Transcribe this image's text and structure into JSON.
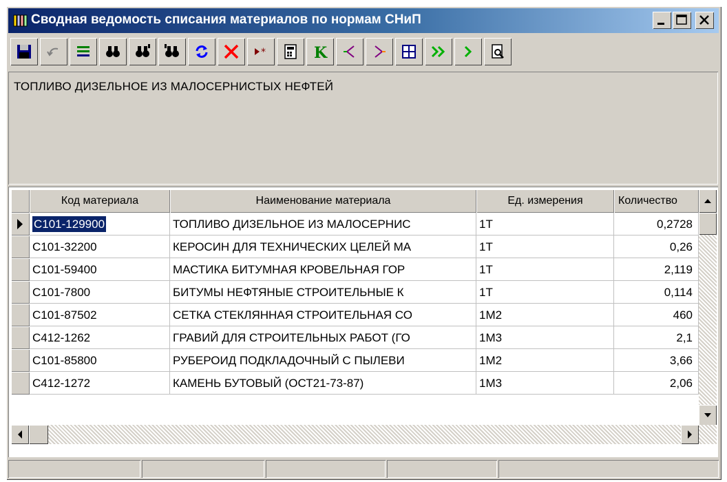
{
  "window": {
    "title": "Сводная ведомость списания материалов по нормам СНиП",
    "controls": [
      "minimize",
      "maximize",
      "close"
    ]
  },
  "toolbar": {
    "buttons": [
      {
        "name": "save",
        "icon": "floppy-disk-icon",
        "color": "#000080"
      },
      {
        "name": "undo",
        "icon": "undo-arrow-icon",
        "color": "#808080"
      },
      {
        "name": "filter",
        "icon": "filter-icon",
        "color": "#008000"
      },
      {
        "name": "find",
        "icon": "binoculars-icon",
        "color": "#000000"
      },
      {
        "name": "find-next",
        "icon": "binoculars-icon",
        "color": "#000000"
      },
      {
        "name": "find-prev",
        "icon": "binoculars-icon",
        "color": "#000000"
      },
      {
        "name": "refresh",
        "icon": "refresh-icon",
        "color": "#0000ff"
      },
      {
        "name": "delete",
        "icon": "red-x-icon",
        "color": "#ff0000"
      },
      {
        "name": "insert-record",
        "icon": "insert-record-icon",
        "color": "#800000"
      },
      {
        "name": "calculator",
        "icon": "calculator-icon",
        "color": "#000000"
      },
      {
        "name": "k-letter",
        "icon": "k-letter-icon",
        "color": "#008000",
        "text": "K"
      },
      {
        "name": "merge-left",
        "icon": "merge-left-icon",
        "color": "#800080"
      },
      {
        "name": "split-right",
        "icon": "split-right-icon",
        "color": "#800080"
      },
      {
        "name": "grid-view",
        "icon": "grid-icon",
        "color": "#000080"
      },
      {
        "name": "fast-forward",
        "icon": "double-chevron-icon",
        "color": "#00a000"
      },
      {
        "name": "next",
        "icon": "chevron-right-icon",
        "color": "#00a000"
      },
      {
        "name": "preview",
        "icon": "print-preview-icon",
        "color": "#000000"
      }
    ]
  },
  "memo": {
    "text": "ТОПЛИВО ДИЗЕЛЬНОЕ ИЗ МАЛОСЕРНИСТЫХ НЕФТЕЙ"
  },
  "grid": {
    "columns": [
      "Код материала",
      "Наименование материала",
      "Ед. измерения",
      "Количество"
    ],
    "rows": [
      {
        "code": "С101-129900",
        "name": "ТОПЛИВО ДИЗЕЛЬНОЕ ИЗ МАЛОСЕРНИС",
        "unit": "1Т",
        "qty": "0,2728"
      },
      {
        "code": "С101-32200",
        "name": "КЕРОСИН ДЛЯ ТЕХНИЧЕСКИХ ЦЕЛЕЙ МА",
        "unit": "1Т",
        "qty": "0,26"
      },
      {
        "code": "С101-59400",
        "name": "МАСТИКА БИТУМНАЯ КРОВЕЛЬНАЯ ГОР",
        "unit": "1Т",
        "qty": "2,119"
      },
      {
        "code": "С101-7800",
        "name": "БИТУМЫ НЕФТЯНЫЕ СТРОИТЕЛЬНЫЕ К",
        "unit": "1Т",
        "qty": "0,114"
      },
      {
        "code": "С101-87502",
        "name": "СЕТКА СТЕКЛЯННАЯ СТРОИТЕЛЬНАЯ СО",
        "unit": "1М2",
        "qty": "460"
      },
      {
        "code": "С412-1262",
        "name": "ГРАВИЙ ДЛЯ СТРОИТЕЛЬНЫХ РАБОТ (ГО",
        "unit": "1М3",
        "qty": "2,1"
      },
      {
        "code": "С101-85800",
        "name": "РУБЕРОИД ПОДКЛАДОЧНЫЙ С ПЫЛЕВИ",
        "unit": "1М2",
        "qty": "3,66"
      },
      {
        "code": "С412-1272",
        "name": "КАМЕНЬ БУТОВЫЙ (ОСТ21-73-87)",
        "unit": "1М3",
        "qty": "2,06"
      }
    ],
    "selected_row": 0
  },
  "statusbar": {
    "panels": [
      "",
      "",
      "",
      "",
      ""
    ]
  }
}
